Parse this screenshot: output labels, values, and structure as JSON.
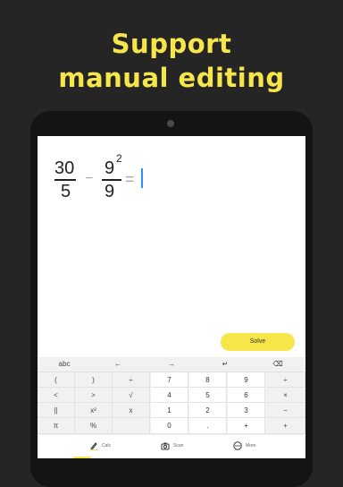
{
  "headline": {
    "line1": "Support",
    "line2": "manual editing"
  },
  "expression": {
    "frac1": {
      "numerator": "30",
      "denominator": "5"
    },
    "operator": "−",
    "frac2": {
      "numerator": "9",
      "exponent": "2",
      "denominator": "9"
    },
    "equals": "="
  },
  "solve_label": "Solve",
  "keyboard": {
    "top_row": [
      "abc",
      "←",
      "→",
      "↵",
      "⌫"
    ],
    "rows": [
      [
        "(",
        ")",
        "÷",
        "7",
        "8",
        "9",
        "÷"
      ],
      [
        "<",
        ">",
        "√",
        "4",
        "5",
        "6",
        "×"
      ],
      [
        "||",
        "x²",
        "x",
        "1",
        "2",
        "3",
        "−"
      ],
      [
        "π",
        "%",
        "",
        "0",
        ".",
        "+",
        "+"
      ]
    ]
  },
  "nav": {
    "calc": "Calc",
    "scan": "Scan",
    "more": "More"
  },
  "colors": {
    "accent": "#f7e64a",
    "background": "#252525",
    "cursor": "#2196f3"
  }
}
